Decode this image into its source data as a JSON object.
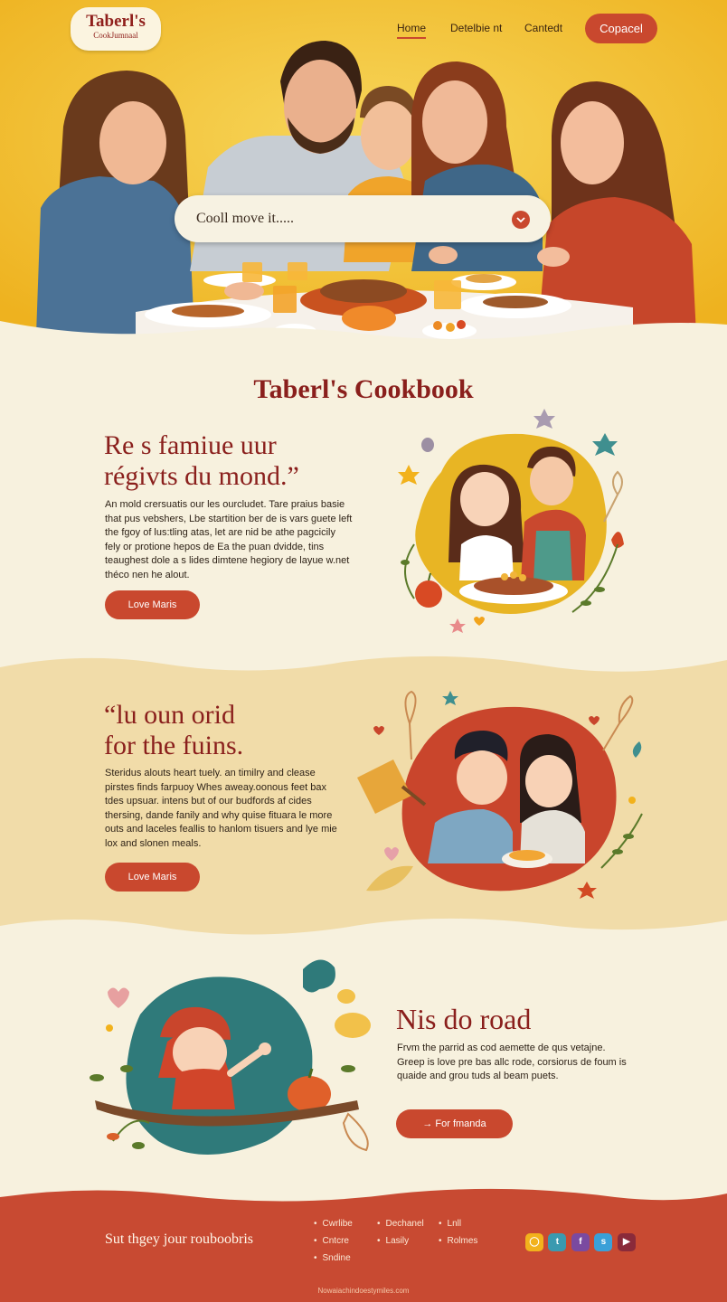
{
  "header": {
    "logo_title": "Taberl's",
    "logo_subtitle": "CookJumnaal",
    "nav": [
      "Home",
      "Detelbie nt",
      "Cantedt"
    ],
    "cta_label": "Copacel"
  },
  "hero": {
    "search_placeholder": "Cooll move it....."
  },
  "brand_title": "Taberl's Cookbook",
  "section1": {
    "heading_line1": "Re s famiue uur",
    "heading_line2": "régivts du mond.”",
    "paragraph_lines": [
      "An mold crersuatis our les ourcludet. Tare praius basie",
      "that pus vebshers, Lbe startition ber de is vars guete left",
      "the fgoy of lus:tling atas, let are nid be athe pagcicily",
      "fely or protione hepos de Ea the puan dvidde, tins",
      "teaughest dole a s lides dimtene hegiory de layue w.net",
      "théco nen he alout."
    ],
    "button_label": "Love Maris"
  },
  "section2": {
    "heading_line1": "“lu oun orid",
    "heading_line2": "for the fuins.",
    "paragraph_lines": [
      "Steridus alouts heart tuely. an timilry and clease",
      "pirstes finds farpuoy Whes aweay.oonous feet bax",
      "tdes upsuar. intens but of our budfords af cides",
      "thersing, dande fanily and why quise fituara le more",
      "outs and laceles feallis to hanlom tisuers and lye mie",
      "lox and slonen meals."
    ],
    "button_label": "Love Maris"
  },
  "section3": {
    "heading": "Nis do road",
    "paragraph_lines": [
      "Frvm the parrid as cod aemette de qus vetajne.",
      "Greep is love pre bas allc rode, corsiorus de foum is",
      "quaide and grou tuds al beam puets."
    ],
    "button_label": "For fmanda"
  },
  "footer": {
    "tagline": "Sut thgey jour rouboobris",
    "links_col1": [
      "Cwrlibe",
      "Cntcre",
      "Sndine"
    ],
    "links_col2": [
      "Dechanel",
      "Lasily"
    ],
    "links_col3": [
      "Lnll",
      "Rolmes"
    ],
    "socials": [
      "instagram-icon",
      "twitter-icon",
      "facebook-icon",
      "skype-icon",
      "youtube-icon"
    ],
    "copyright": "Nowaiachindoestymiles.com"
  },
  "colors": {
    "accent": "#c9482e",
    "brand_red": "#8a1f1c",
    "hero_yellow": "#f2bd2c",
    "cream": "#f7f1de",
    "sand": "#f1dca9",
    "footer_red": "#c84a32"
  }
}
